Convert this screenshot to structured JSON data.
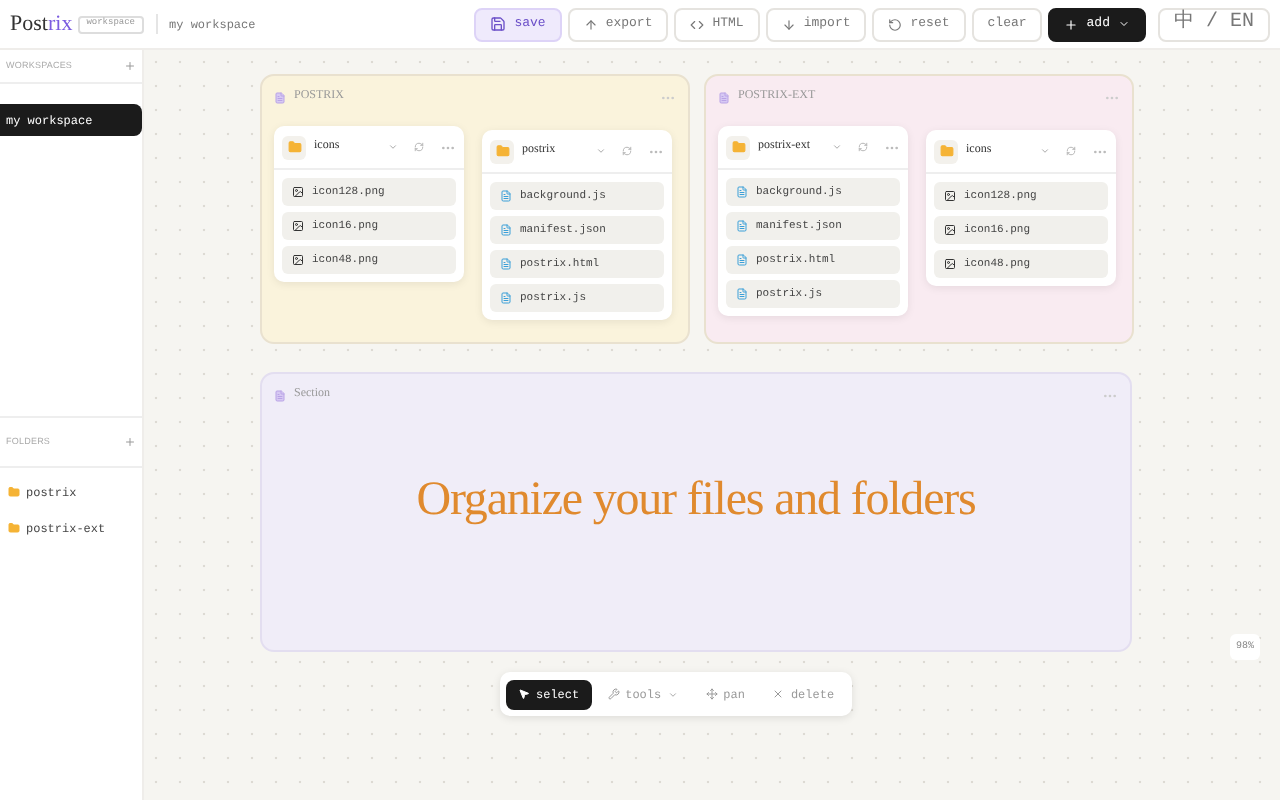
{
  "header": {
    "logo": {
      "main": "Post",
      "accent": "rix"
    },
    "badge": "workspace",
    "workspace": "my workspace",
    "buttons": [
      {
        "kind": "save",
        "label": "save"
      },
      {
        "kind": "export",
        "label": "export"
      },
      {
        "kind": "html",
        "label": "HTML"
      },
      {
        "kind": "import",
        "label": "import"
      },
      {
        "kind": "reset",
        "label": "reset"
      },
      {
        "kind": "clear",
        "label": "clear"
      },
      {
        "kind": "add",
        "label": "add"
      },
      {
        "kind": "lang",
        "label": "中 / EN"
      }
    ]
  },
  "sidebar": {
    "workspaces": {
      "title": "WORKSPACES",
      "items": [
        {
          "label": "my workspace",
          "selected": true
        }
      ]
    },
    "folders": {
      "title": "FOLDERS",
      "items": [
        {
          "label": "postrix"
        },
        {
          "label": "postrix-ext"
        }
      ]
    }
  },
  "canvas": {
    "groups": [
      {
        "title": "POSTRIX",
        "color": "#faf3dc",
        "folders": [
          {
            "name": "icons",
            "files": [
              {
                "name": "icon128.png",
                "kind": "image"
              },
              {
                "name": "icon16.png",
                "kind": "image"
              },
              {
                "name": "icon48.png",
                "kind": "image"
              }
            ]
          },
          {
            "name": "postrix",
            "files": [
              {
                "name": "background.js",
                "kind": "code"
              },
              {
                "name": "manifest.json",
                "kind": "code"
              },
              {
                "name": "postrix.html",
                "kind": "code"
              },
              {
                "name": "postrix.js",
                "kind": "code"
              }
            ]
          }
        ]
      },
      {
        "title": "POSTRIX-EXT",
        "color": "#f9ebf1",
        "folders": [
          {
            "name": "postrix-ext",
            "files": [
              {
                "name": "background.js",
                "kind": "code"
              },
              {
                "name": "manifest.json",
                "kind": "code"
              },
              {
                "name": "postrix.html",
                "kind": "code"
              },
              {
                "name": "postrix.js",
                "kind": "code"
              }
            ]
          },
          {
            "name": "icons",
            "files": [
              {
                "name": "icon128.png",
                "kind": "image"
              },
              {
                "name": "icon16.png",
                "kind": "image"
              },
              {
                "name": "icon48.png",
                "kind": "image"
              }
            ]
          }
        ]
      }
    ],
    "section": {
      "title": "Section",
      "headline": "Organize your files and folders"
    },
    "toolbar": [
      {
        "kind": "select",
        "label": "select",
        "selected": true
      },
      {
        "kind": "tools",
        "label": "tools",
        "selected": false
      },
      {
        "kind": "pan",
        "label": "pan",
        "selected": false
      },
      {
        "kind": "delete",
        "label": "delete",
        "selected": false
      }
    ],
    "zoom": "98%"
  }
}
